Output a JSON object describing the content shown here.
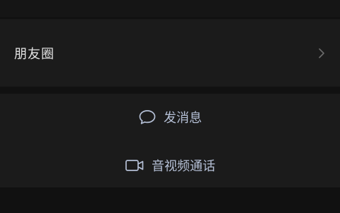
{
  "moments": {
    "label": "朋友圈"
  },
  "actions": {
    "message_label": "发消息",
    "call_label": "音视频通话"
  },
  "icons": {
    "chevron": "chevron-right-icon",
    "message": "chat-bubble-icon",
    "call": "video-camera-icon"
  },
  "colors": {
    "background": "#111111",
    "panel": "#1b1b1b",
    "label": "#e4e4e4",
    "action_text": "#b4bfd5",
    "chevron": "#6b6b6b"
  }
}
